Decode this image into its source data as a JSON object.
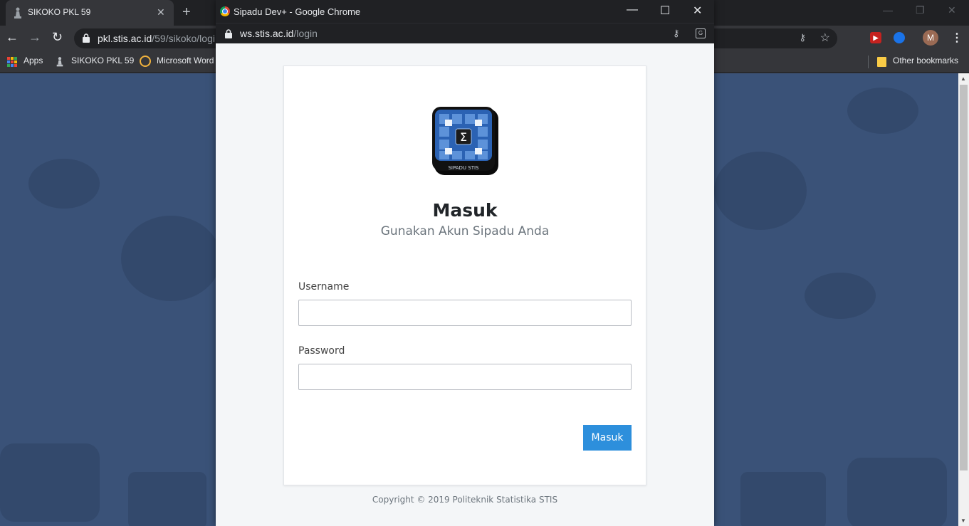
{
  "background_browser": {
    "tab_title": "SIKOKO PKL 59",
    "url_host": "pkl.stis.ac.id",
    "url_path": "/59/sikoko/logi",
    "avatar_letter": "M",
    "bookmarks": {
      "apps": "Apps",
      "sikoko": "SIKOKO PKL 59",
      "word": "Microsoft Word",
      "other": "Other bookmarks"
    }
  },
  "popup": {
    "window_title": "Sipadu Dev+ - Google Chrome",
    "url_host": "ws.stis.ac.id",
    "url_path": "/login",
    "logo_text": "SIPADU STIS",
    "heading": "Masuk",
    "subheading": "Gunakan Akun Sipadu Anda",
    "username_label": "Username",
    "username_value": "",
    "password_label": "Password",
    "password_value": "",
    "submit_label": "Masuk",
    "copyright": "Copyright © 2019 Politeknik Statistika STIS"
  },
  "colors": {
    "page_background": "#3a5278",
    "submit_button": "#2d8fdc",
    "chrome_dark": "#202124"
  }
}
